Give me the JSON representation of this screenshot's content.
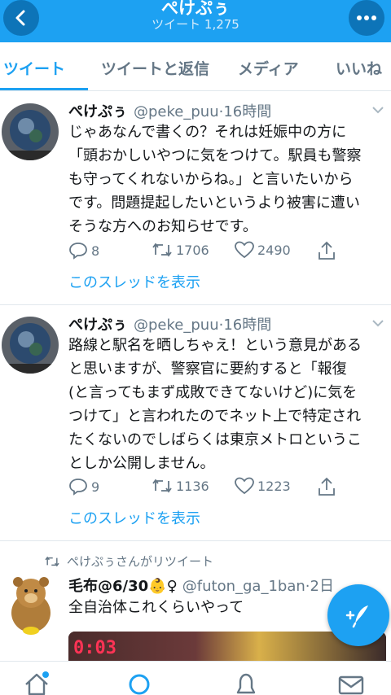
{
  "header": {
    "title": "ぺけぷぅ",
    "subtitle": "ツイート 1,275",
    "back_icon": "back-arrow-icon",
    "more_icon": "more-dots-icon",
    "accent_color": "#1da1f2"
  },
  "tabs": [
    {
      "label": "ツイート",
      "active": true
    },
    {
      "label": "ツイートと返信",
      "active": false
    },
    {
      "label": "メディア",
      "active": false
    },
    {
      "label": "いいね",
      "active": false
    }
  ],
  "tweets": [
    {
      "name": "ぺけぷぅ",
      "handle": "@peke_puu",
      "time": "·16時間",
      "lines": [
        "じゃあなんで書くの？それは妊娠中の方に",
        "「頭おかしいやつに気をつけて。駅員も警察",
        "も守ってくれないからね。」と言いたいから",
        "です。問題提起したいというより被害に遭い",
        "そうな方へのお知らせです。"
      ],
      "replies": "8",
      "retweets": "1706",
      "likes": "2490",
      "thread_link": "このスレッドを表示"
    },
    {
      "name": "ぺけぷぅ",
      "handle": "@peke_puu",
      "time": "·16時間",
      "lines": [
        "路線と駅名を晒しちゃえ！という意見がある",
        "と思いますが、警察官に要約すると「報復",
        "(と言ってもまず成敗できてないけど)に気を",
        "つけて」と言われたのでネット上で特定され",
        "たくないのでしばらくは東京メトロというこ",
        "としか公開しません。"
      ],
      "replies": "9",
      "retweets": "1136",
      "likes": "1223",
      "thread_link": "このスレッドを表示"
    }
  ],
  "retweet": {
    "context": "ぺけぷぅさんがリツイート",
    "name": "毛布@6/30",
    "emoji": "👶♀",
    "handle": "@futon_ga_1ban",
    "time": "·2日",
    "text": "全自治体これくらいやって",
    "media_text": "0:03"
  },
  "bottom_nav": [
    "home-icon",
    "search-icon",
    "notifications-icon",
    "messages-icon"
  ]
}
